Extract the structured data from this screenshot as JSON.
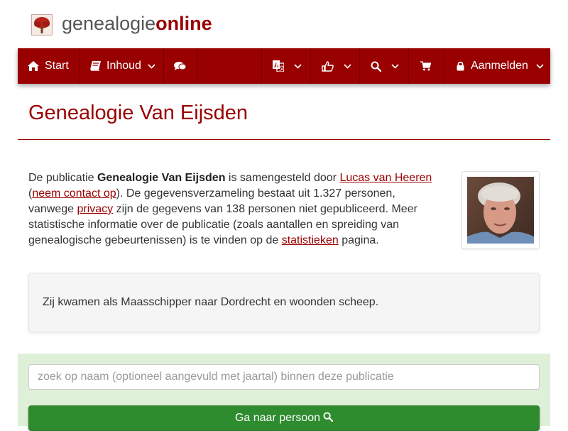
{
  "brand": {
    "part1": "genealogie",
    "part2": "online",
    "icon": "tree-logo-icon"
  },
  "nav": {
    "start": "Start",
    "inhoud": "Inhoud",
    "login": "Aanmelden",
    "icons": [
      "home-icon",
      "book-icon",
      "chat-icon",
      "translate-icon",
      "thumbs-up-icon",
      "search-icon",
      "cart-icon",
      "lock-icon"
    ]
  },
  "page": {
    "title": "Genealogie Van Eijsden"
  },
  "intro": {
    "t1": "De publicatie ",
    "pub_name": "Genealogie Van Eijsden",
    "t2": " is samengesteld door ",
    "author_link": "Lucas van Heeren",
    "t3": " (",
    "contact_link": "neem contact op",
    "t4": "). De gegevensverzameling bestaat uit 1.327 personen, vanwege ",
    "privacy_link": "privacy",
    "t5": " zijn de gegevens van 138 personen niet gepubliceerd. Meer statistische informatie over de publicatie (zoals aantallen en spreiding van genealogische gebeurtenissen) is te vinden op de ",
    "stats_link": "statistieken",
    "t6": " pagina."
  },
  "note": "Zij kwamen als Maasschipper naar Dordrecht en woonden scheep.",
  "search": {
    "placeholder": "zoek op naam (optioneel aangevuld met jaartal) binnen deze publicatie",
    "button": "Ga naar persoon"
  },
  "colors": {
    "brand": "#990000",
    "success": "#2e8b2e",
    "panel": "#dff0d8"
  }
}
